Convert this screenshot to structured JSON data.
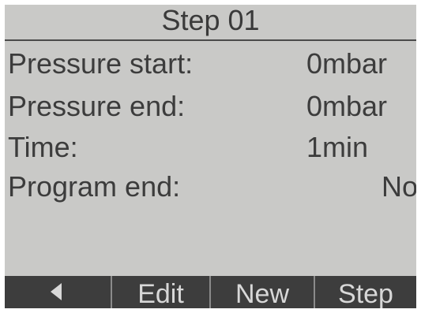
{
  "header": {
    "title": "Step 01"
  },
  "fields": [
    {
      "label": "Pressure start:",
      "value": "0mbar"
    },
    {
      "label": "Pressure end:",
      "value": "0mbar"
    },
    {
      "label": "Time:",
      "value": "1min"
    },
    {
      "label": "Program end:",
      "value": "No"
    }
  ],
  "softkeys": {
    "back_icon": "left-arrow-icon",
    "edit_label": "Edit",
    "new_label": "New",
    "step_label": "Step"
  },
  "colors": {
    "screen_background": "#c9c9c7",
    "text": "#3c3c3c",
    "softkey_bar": "#3d3d3d",
    "softkey_text": "#d8d8d8"
  }
}
